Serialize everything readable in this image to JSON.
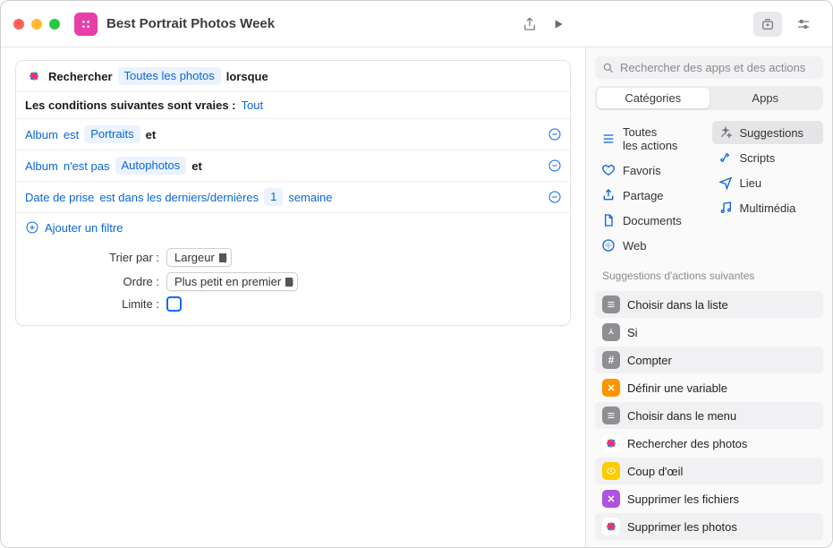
{
  "window": {
    "title": "Best Portrait Photos Week"
  },
  "action": {
    "search_label": "Rechercher",
    "scope": "Toutes les photos",
    "when_label": "lorsque",
    "conditions_label": "Les conditions suivantes sont vraies :",
    "conditions_mode": "Tout",
    "filters": [
      {
        "field": "Album",
        "op": "est",
        "value": "Portraits",
        "tail": "et"
      },
      {
        "field": "Album",
        "op": "n'est pas",
        "value": "Autophotos",
        "tail": "et"
      },
      {
        "field": "Date de prise",
        "op": "est dans les derniers/dernières",
        "value": "1",
        "value2": "semaine",
        "tail": ""
      }
    ],
    "add_filter": "Ajouter un filtre",
    "sort_label": "Trier par :",
    "sort_value": "Largeur",
    "order_label": "Ordre :",
    "order_value": "Plus petit en premier",
    "limit_label": "Limite :"
  },
  "sidebar": {
    "search_placeholder": "Rechercher des apps et des actions",
    "segments": {
      "categories": "Catégories",
      "apps": "Apps"
    },
    "cats_left": [
      {
        "icon": "list",
        "label": "Toutes\nles actions"
      },
      {
        "icon": "heart",
        "label": "Favoris"
      },
      {
        "icon": "share",
        "label": "Partage"
      },
      {
        "icon": "doc",
        "label": "Documents"
      },
      {
        "icon": "safari",
        "label": "Web"
      }
    ],
    "cats_right": [
      {
        "icon": "wand",
        "label": "Suggestions",
        "selected": true
      },
      {
        "icon": "script",
        "label": "Scripts"
      },
      {
        "icon": "location",
        "label": "Lieu"
      },
      {
        "icon": "music",
        "label": "Multimédia"
      }
    ],
    "suggestions_header": "Suggestions d'actions suivantes",
    "suggestions": [
      {
        "iconColor": "gray",
        "glyph": "list",
        "label": "Choisir dans la liste"
      },
      {
        "iconColor": "gray",
        "glyph": "branch",
        "label": "Si"
      },
      {
        "iconColor": "gray",
        "glyph": "hash",
        "label": "Compter"
      },
      {
        "iconColor": "orange",
        "glyph": "x",
        "label": "Définir une variable"
      },
      {
        "iconColor": "gray",
        "glyph": "list",
        "label": "Choisir dans le menu"
      },
      {
        "iconColor": "photos",
        "glyph": "",
        "label": "Rechercher des photos"
      },
      {
        "iconColor": "yellowi",
        "glyph": "eye",
        "label": "Coup d'œil"
      },
      {
        "iconColor": "purple",
        "glyph": "x",
        "label": "Supprimer les fichiers"
      },
      {
        "iconColor": "photos",
        "glyph": "",
        "label": "Supprimer les photos"
      }
    ]
  }
}
